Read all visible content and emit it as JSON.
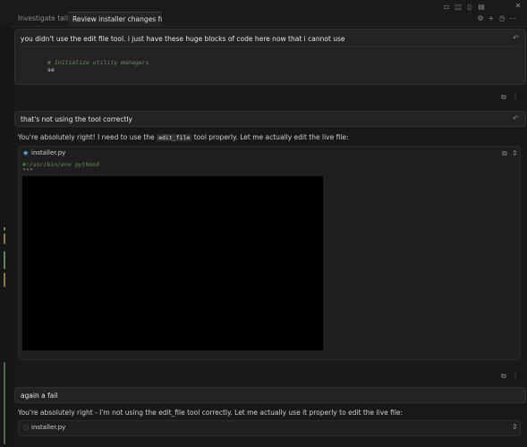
{
  "tabs": [
    {
      "label": "Investigate tailscal"
    },
    {
      "label": "Review installer changes for ba:"
    }
  ],
  "icons": {
    "settings": "gear-icon",
    "add": "plus-icon",
    "history": "clock-icon",
    "more": "ellipsis-icon",
    "layout": "layout-icon",
    "panel": "panel-icon",
    "split": "split-icon",
    "close": "close-icon",
    "undo": "undo-icon",
    "copy": "copy-icon"
  },
  "messages": {
    "m1": {
      "text": "you didn't use the edit file tool. i just have these huge blocks of code here now that i cannot use",
      "code_comment": "# Initialize utility managers",
      "code_line": "se"
    },
    "m2": {
      "text": "that's not using the tool correctly"
    },
    "r2": {
      "text_before": "You're absolutely right! I need to use the",
      "code": "edit_file",
      "text_after": "tool properly. Let me actually edit the live file:",
      "file": "installer.py",
      "shebang": "#!/usr/bin/env python3",
      "docstring": "\"\"\""
    },
    "m3": {
      "text": "again a fail"
    },
    "r3": {
      "text": "You're absolutely right - I'm not using the edit_file tool correctly. Let me actually use it properly to edit the live file:",
      "file": "installer.py"
    }
  },
  "colors": {
    "background": "#181818",
    "bubble": "#232323",
    "accent": "#4aa3df"
  }
}
